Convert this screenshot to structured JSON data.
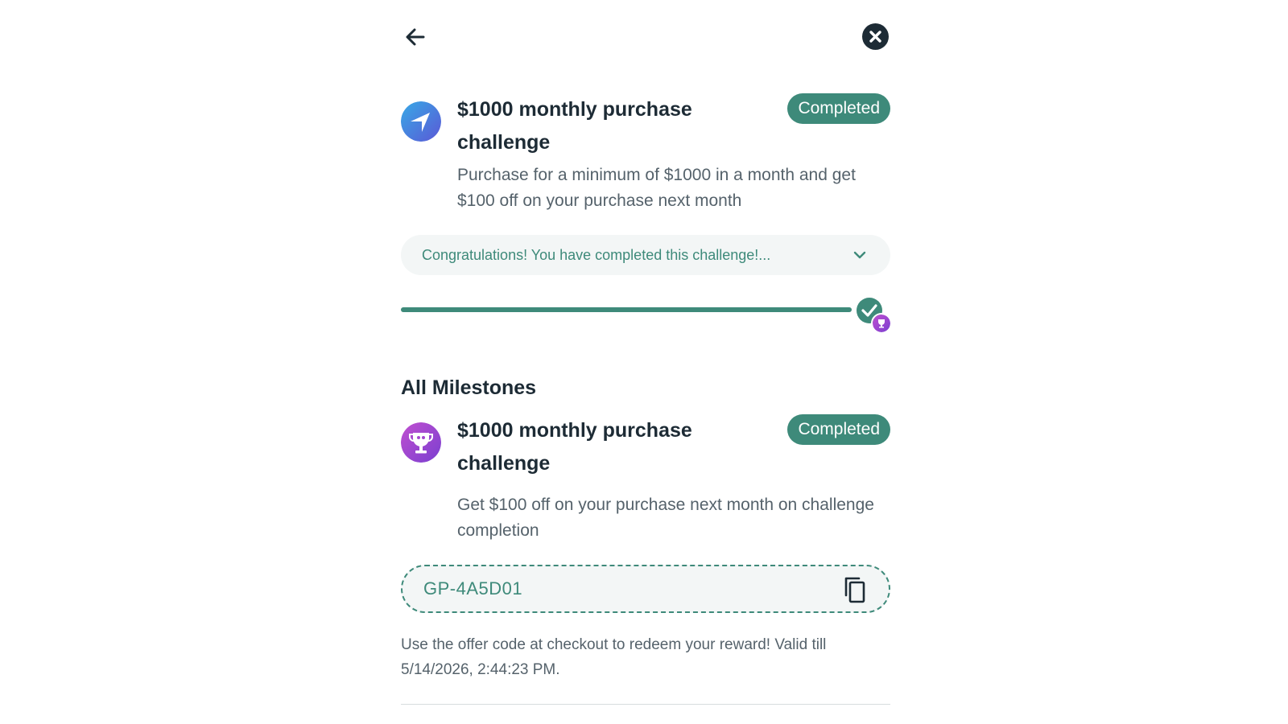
{
  "header": {
    "back_icon": "arrow-left-icon",
    "close_icon": "close-circle-icon"
  },
  "challenge": {
    "icon": "navigation-arrow-icon",
    "title": "$1000 monthly purchase challenge",
    "status": "Completed",
    "description": "Purchase for a minimum of $1000 in a month and get $100 off on your purchase next month",
    "congrats_message": "Congratulations! You have completed this challenge!...",
    "progress_fraction": 1.0
  },
  "milestones": {
    "heading": "All Milestones",
    "items": [
      {
        "icon": "trophy-icon",
        "title": "$1000 monthly purchase challenge",
        "status": "Completed",
        "description": "Get $100 off on your purchase next month on challenge completion",
        "offer_code": "GP-4A5D01",
        "redeem_note": "Use the offer code at checkout to redeem your reward! Valid till 5/14/2026, 2:44:23 PM."
      }
    ]
  },
  "colors": {
    "accent": "#3e8a7a",
    "text_dark": "#1d2b35",
    "text_muted": "#55626b",
    "soft_bg": "#f3f6f6"
  }
}
